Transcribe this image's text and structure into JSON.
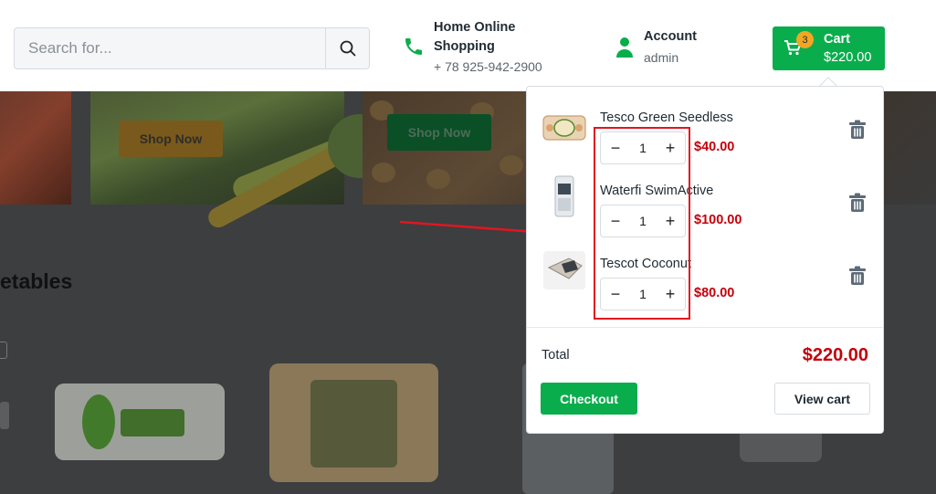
{
  "search": {
    "placeholder": "Search for..."
  },
  "contact": {
    "title_line1": "Home Online",
    "title_line2": "Shopping",
    "phone": "+ 78 925-942-2900"
  },
  "account": {
    "label": "Account",
    "user": "admin"
  },
  "cart": {
    "badge": "3",
    "label": "Cart",
    "total": "$220.00"
  },
  "background": {
    "banners": [
      {
        "button": "Shop Now"
      },
      {
        "button": "Shop Now"
      }
    ],
    "section_title": "etables"
  },
  "dropdown": {
    "items": [
      {
        "name": "Tesco Green Seedless",
        "qty": "1",
        "price": "$40.00"
      },
      {
        "name": "Waterfi SwimActive",
        "qty": "1",
        "price": "$100.00"
      },
      {
        "name": "Tescot Coconut",
        "qty": "1",
        "price": "$80.00"
      }
    ],
    "total_label": "Total",
    "total_value": "$220.00",
    "checkout_label": "Checkout",
    "view_cart_label": "View cart"
  },
  "colors": {
    "accent": "#0aad4c",
    "price": "#c5000b",
    "annotation": "#e0161f",
    "badge": "#f2a623"
  },
  "icons": [
    "search-icon",
    "phone-icon",
    "user-icon",
    "cart-icon",
    "trash-icon",
    "minus-icon",
    "plus-icon"
  ]
}
